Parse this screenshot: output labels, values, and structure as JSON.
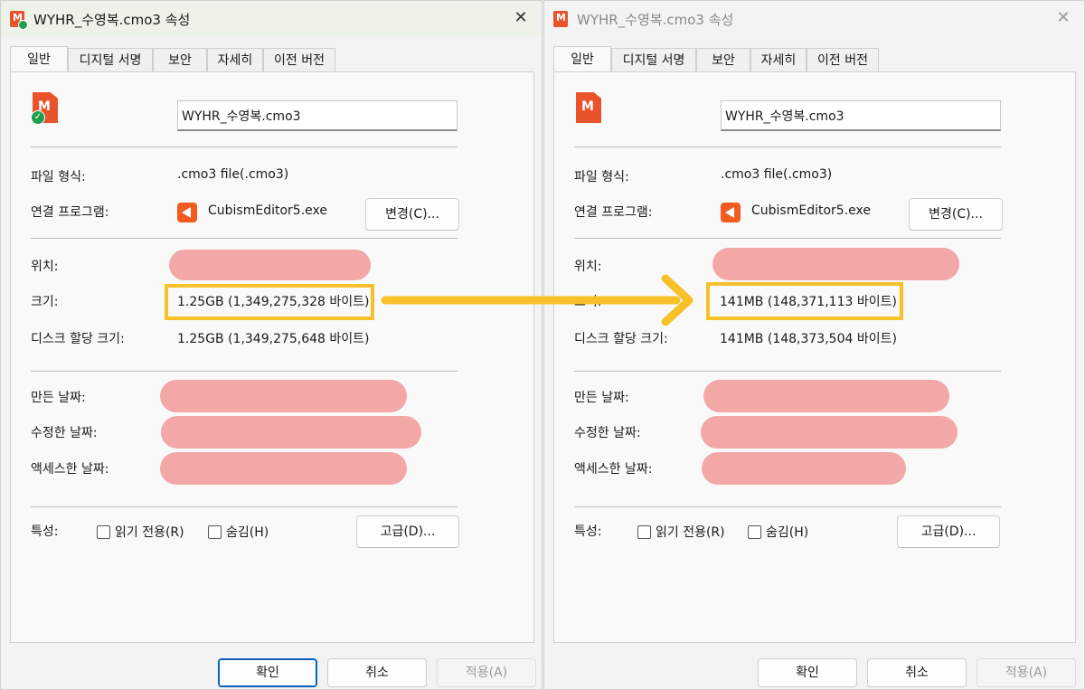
{
  "left": {
    "title": "WYHR_수영복.cmo3 속성",
    "close_icon": "✕",
    "tabs": [
      "일반",
      "디지털 서명",
      "보안",
      "자세히",
      "이전 버전"
    ],
    "filename": "WYHR_수영복.cmo3",
    "filetype_label": "파일 형식:",
    "filetype_value": ".cmo3 file(.cmo3)",
    "program_label": "연결 프로그램:",
    "program_value": "CubismEditor5.exe",
    "change_button": "변경(C)...",
    "location_label": "위치:",
    "size_label": "크기:",
    "size_value": "1.25GB (1,349,275,328 바이트)",
    "disk_label": "디스크 할당 크기:",
    "disk_value": "1.25GB (1,349,275,648 바이트)",
    "created_label": "만든 날짜:",
    "modified_label": "수정한 날짜:",
    "accessed_label": "액세스한 날짜:",
    "attr_label": "특성:",
    "readonly_label": "읽기 전용(R)",
    "hidden_label": "숨김(H)",
    "advanced_button": "고급(D)...",
    "ok_button": "확인",
    "cancel_button": "취소",
    "apply_button": "적용(A)"
  },
  "right": {
    "title": "WYHR_수영복.cmo3 속성",
    "close_icon": "✕",
    "tabs": [
      "일반",
      "디지털 서명",
      "보안",
      "자세히",
      "이전 버전"
    ],
    "filename": "WYHR_수영복.cmo3",
    "filetype_label": "파일 형식:",
    "filetype_value": ".cmo3 file(.cmo3)",
    "program_label": "연결 프로그램:",
    "program_value": "CubismEditor5.exe",
    "change_button": "변경(C)...",
    "location_label": "위치:",
    "size_label": "크기:",
    "size_value": "141MB (148,371,113 바이트)",
    "disk_label": "디스크 할당 크기:",
    "disk_value": "141MB (148,373,504 바이트)",
    "created_label": "만든 날짜:",
    "modified_label": "수정한 날짜:",
    "accessed_label": "액세스한 날짜:",
    "attr_label": "특성:",
    "readonly_label": "읽기 전용(R)",
    "hidden_label": "숨김(H)",
    "advanced_button": "고급(D)...",
    "ok_button": "확인",
    "cancel_button": "취소",
    "apply_button": "적용(A)"
  },
  "colors": {
    "highlight": "#f7c12a",
    "redaction": "#f4a7a7",
    "app_accent": "#e8532b"
  }
}
